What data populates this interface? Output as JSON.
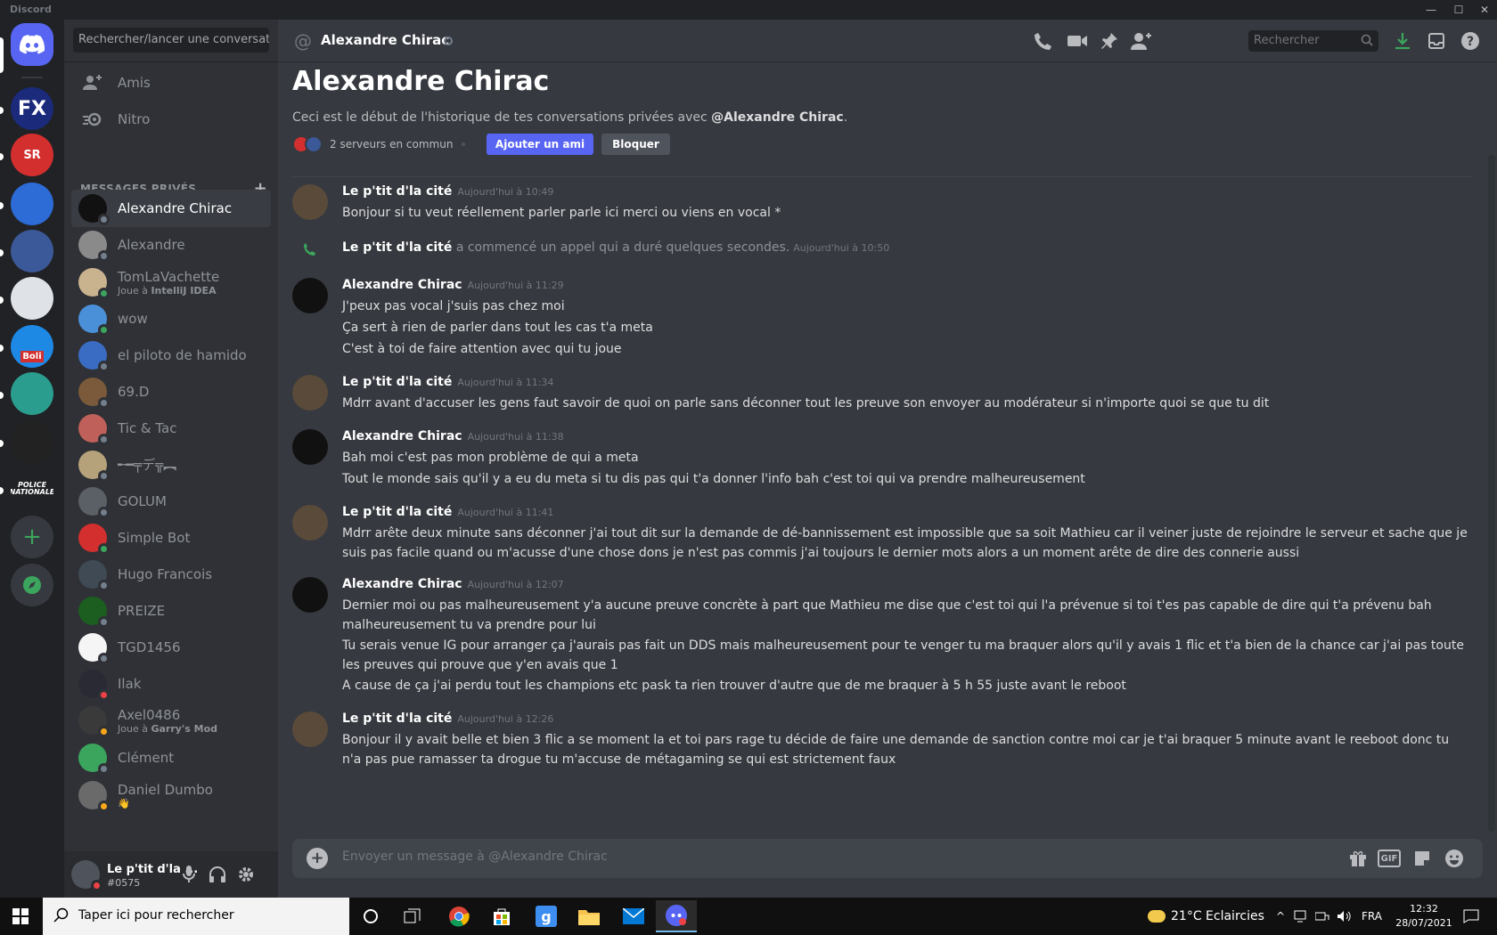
{
  "app": {
    "name": "Discord",
    "window_controls": [
      "—",
      "☐",
      "✕"
    ]
  },
  "guilds": [
    {
      "label": "FX",
      "color": "#1b2a7a"
    },
    {
      "label": "SR",
      "color": "#d32f2f"
    },
    {
      "label": "",
      "color": "#2d6bd6"
    },
    {
      "label": "",
      "color": "#3b5998"
    },
    {
      "label": "",
      "color": "#dfe3e8"
    },
    {
      "label": "Boli",
      "color": "#1e88e5"
    },
    {
      "label": "",
      "color": "#2a9d8f"
    },
    {
      "label": "",
      "color": "#222222"
    },
    {
      "label": "POLICE NATIONALE",
      "color": "#202225"
    }
  ],
  "sidebar": {
    "search_label": "Rechercher/lancer une conversat...",
    "nav": [
      {
        "label": "Amis",
        "icon": "friends-icon"
      },
      {
        "label": "Nitro",
        "icon": "nitro-icon"
      }
    ],
    "dm_header": "MESSAGES PRIVÉS",
    "dm_add": "+",
    "dms": [
      {
        "name": "Alexandre Chirac",
        "sub": "",
        "sub_bold": "",
        "avatar": "#111111",
        "status": "#747f8d",
        "active": true
      },
      {
        "name": "Alexandre",
        "sub": "",
        "sub_bold": "",
        "avatar": "#8a8a8a",
        "status": "#747f8d"
      },
      {
        "name": "TomLaVachette",
        "sub": "Joue à ",
        "sub_bold": "IntelliJ IDEA",
        "avatar": "#c9b38f",
        "status": "#3ba55d"
      },
      {
        "name": "wow",
        "sub": "",
        "sub_bold": "",
        "avatar": "#4a90d9",
        "status": "#3ba55d"
      },
      {
        "name": "el piloto de hamido",
        "sub": "",
        "sub_bold": "",
        "avatar": "#3a6cc4",
        "status": "#747f8d"
      },
      {
        "name": "69.D",
        "sub": "",
        "sub_bold": "",
        "avatar": "#7a5a3a",
        "status": "#747f8d"
      },
      {
        "name": "Tic & Tac",
        "sub": "",
        "sub_bold": "",
        "avatar": "#c0605a",
        "status": "#747f8d"
      },
      {
        "name": "╾━╤デ╦︻",
        "sub": "",
        "sub_bold": "",
        "avatar": "#b6a27a",
        "status": "#747f8d"
      },
      {
        "name": "GOLUM",
        "sub": "",
        "sub_bold": "",
        "avatar": "#5b5f66",
        "status": "#747f8d"
      },
      {
        "name": "Simple Bot",
        "sub": "",
        "sub_bold": "",
        "avatar": "#d32f2f",
        "status": "#3ba55d"
      },
      {
        "name": "Hugo Francois",
        "sub": "",
        "sub_bold": "",
        "avatar": "#3f4a55",
        "status": "#747f8d"
      },
      {
        "name": "PREIZE",
        "sub": "",
        "sub_bold": "",
        "avatar": "#1b5e20",
        "status": "#747f8d"
      },
      {
        "name": "TGD1456",
        "sub": "",
        "sub_bold": "",
        "avatar": "#f5f5f5",
        "status": "#747f8d"
      },
      {
        "name": "Ilak",
        "sub": "",
        "sub_bold": "",
        "avatar": "#2a2a35",
        "status": "#ed4245"
      },
      {
        "name": "Axel0486",
        "sub": "Joue à ",
        "sub_bold": "Garry's Mod",
        "avatar": "#3a3a3a",
        "status": "#faa81a"
      },
      {
        "name": "Clément",
        "sub": "",
        "sub_bold": "",
        "avatar": "#3ba55d",
        "status": "#747f8d"
      },
      {
        "name": "Daniel Dumbo",
        "sub": "👋",
        "sub_bold": "",
        "avatar": "#6a6a6a",
        "status": "#faa81a"
      }
    ]
  },
  "user": {
    "name": "Le p'tit d'la ...",
    "tag": "#0575"
  },
  "channel": {
    "title": "Alexandre Chirac",
    "search_placeholder": "Rechercher"
  },
  "intro": {
    "title": "Alexandre Chirac",
    "sub_prefix": "Ceci est le début de l'historique de tes conversations privées avec ",
    "sub_mention": "@Alexandre Chirac",
    "sub_suffix": ".",
    "mutual": "2 serveurs en commun",
    "add_friend": "Ajouter un ami",
    "block": "Bloquer"
  },
  "messages": [
    {
      "author": "Le p'tit d'la cité",
      "ts": "Aujourd'hui à 10:49",
      "lines": [
        "Bonjour si tu veut réellement parler parle ici merci ou viens en vocal *"
      ]
    },
    {
      "system": true,
      "author": "Le p'tit d'la cité",
      "text": " a commencé un appel qui a duré quelques secondes.",
      "ts": "Aujourd'hui à 10:50"
    },
    {
      "author": "Alexandre Chirac",
      "ts": "Aujourd'hui à 11:29",
      "lines": [
        "J'peux pas vocal j'suis pas chez moi",
        "Ça sert à rien de parler dans tout les cas t'a meta",
        "C'est à toi de faire attention avec qui tu joue"
      ]
    },
    {
      "author": "Le p'tit d'la cité",
      "ts": "Aujourd'hui à 11:34",
      "lines": [
        "Mdrr avant d'accuser les gens faut savoir de quoi on parle sans déconner tout les preuve son envoyer au modérateur si n'importe quoi se que tu dit"
      ]
    },
    {
      "author": "Alexandre Chirac",
      "ts": "Aujourd'hui à 11:38",
      "lines": [
        "Bah moi c'est pas mon problème de qui a meta",
        "Tout le monde sais qu'il y a eu du meta si tu dis pas qui t'a donner l'info bah c'est toi qui va prendre malheureusement"
      ]
    },
    {
      "author": "Le p'tit d'la cité",
      "ts": "Aujourd'hui à 11:41",
      "lines": [
        "Mdrr arête deux minute sans déconner j'ai tout dit sur la demande de dé-bannissement est impossible que sa soit Mathieu car il veiner juste de rejoindre le serveur et sache que je suis pas facile quand ou m'acusse d'une chose dons je n'est pas commis j'ai toujours le dernier mots alors a un moment arête de dire des connerie aussi"
      ]
    },
    {
      "author": "Alexandre Chirac",
      "ts": "Aujourd'hui à 12:07",
      "lines": [
        "Dernier moi ou pas malheureusement y'a aucune preuve concrète à part que Mathieu me dise que c'est toi qui l'a prévenue si toi t'es pas capable de dire qui t'a prévenu bah malheureusement tu va prendre pour lui",
        "Tu serais venue IG pour arranger ça j'aurais pas fait un DDS mais malheureusement pour te venger tu ma braquer alors qu'il y avais 1 flic et t'a bien de la chance car j'ai pas toute les preuves qui prouve que y'en avais que 1",
        "A cause de ça j'ai perdu tout les champions etc pask ta rien trouver d'autre que de me braquer à 5 h 55 juste avant le reboot"
      ]
    },
    {
      "author": "Le p'tit d'la cité",
      "ts": "Aujourd'hui à 12:26",
      "lines": [
        "Bonjour il y avait belle et bien 3 flic a se moment la et toi pars rage tu décide de faire une demande de sanction contre moi car je t'ai braquer 5 minute avant le reeboot donc tu n'a pas pue ramasser ta drogue tu m'accuse de métagaming se qui est strictement faux"
      ]
    }
  ],
  "composer": {
    "placeholder": "Envoyer un message à @Alexandre Chirac",
    "gif": "GIF"
  },
  "taskbar": {
    "search": "Taper ici pour rechercher",
    "weather": "21°C  Eclaircies",
    "lang": "FRA",
    "time": "12:32",
    "date": "28/07/2021"
  }
}
